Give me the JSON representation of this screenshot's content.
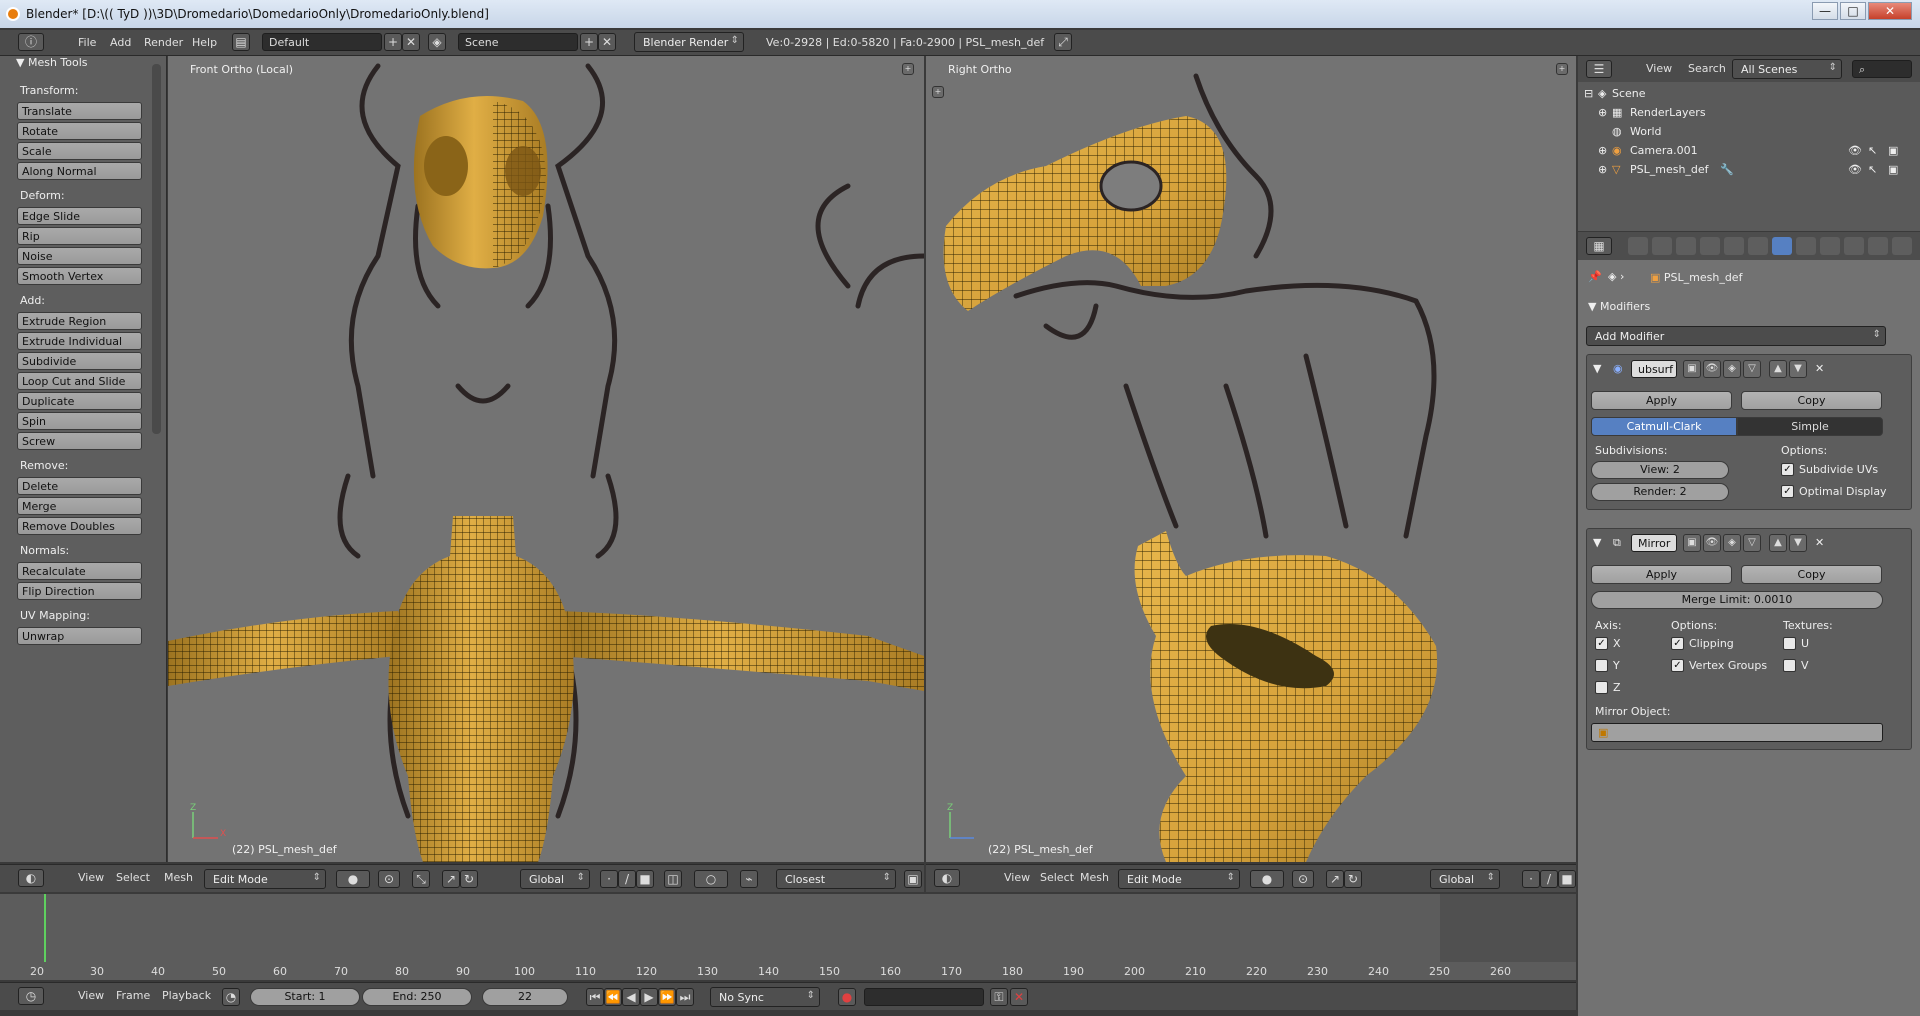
{
  "window": {
    "title": "Blender* [D:\\(( TyD ))\\3D\\Dromedario\\DomedarioOnly\\DromedarioOnly.blend]",
    "buttons": [
      "—",
      "□",
      "✕"
    ]
  },
  "infobar": {
    "menus": [
      "File",
      "Add",
      "Render",
      "Help"
    ],
    "layout": "Default",
    "scene": "Scene",
    "engine": "Blender Render",
    "stats": "Ve:0-2928 | Ed:0-5820 | Fa:0-2900 | PSL_mesh_def"
  },
  "toolshelf": {
    "title": "Mesh Tools",
    "sections": [
      {
        "label": "Transform:",
        "buttons": [
          "Translate",
          "Rotate",
          "Scale",
          "Along Normal"
        ]
      },
      {
        "label": "Deform:",
        "buttons": [
          "Edge Slide",
          "Rip",
          "Noise",
          "Smooth Vertex"
        ]
      },
      {
        "label": "Add:",
        "buttons": [
          "Extrude Region",
          "Extrude Individual",
          "Subdivide",
          "Loop Cut and Slide",
          "Duplicate",
          "Spin",
          "Screw"
        ]
      },
      {
        "label": "Remove:",
        "buttons": [
          "Delete",
          "Merge",
          "Remove Doubles"
        ]
      },
      {
        "label": "Normals:",
        "buttons": [
          "Recalculate",
          "Flip Direction"
        ]
      },
      {
        "label": "UV Mapping:",
        "buttons": [
          "Unwrap"
        ]
      }
    ]
  },
  "viewport_left": {
    "label": "Front Ortho (Local)",
    "footer": "(22) PSL_mesh_def",
    "header": {
      "menus": [
        "View",
        "Select",
        "Mesh"
      ],
      "mode": "Edit Mode",
      "orientation": "Global",
      "snap": "Closest"
    }
  },
  "viewport_right": {
    "label": "Right Ortho",
    "footer": "(22) PSL_mesh_def",
    "header": {
      "menus": [
        "View",
        "Select",
        "Mesh"
      ],
      "mode": "Edit Mode",
      "orientation": "Global"
    }
  },
  "timeline": {
    "ticks": [
      "20",
      "30",
      "40",
      "50",
      "60",
      "70",
      "80",
      "90",
      "100",
      "110",
      "120",
      "130",
      "140",
      "150",
      "160",
      "170",
      "180",
      "190",
      "200",
      "210",
      "220",
      "230",
      "240",
      "250",
      "260"
    ],
    "menus": [
      "View",
      "Frame",
      "Playback"
    ],
    "start": "Start: 1",
    "end": "End: 250",
    "current": "22",
    "sync": "No Sync"
  },
  "outliner": {
    "menus": [
      "View",
      "Search"
    ],
    "filter": "All Scenes",
    "items": [
      "Scene",
      "RenderLayers",
      "World",
      "Camera.001",
      "PSL_mesh_def"
    ]
  },
  "properties": {
    "object": "PSL_mesh_def",
    "section": "Modifiers",
    "add_modifier": "Add Modifier",
    "subsurf": {
      "name": "ubsurf",
      "apply": "Apply",
      "copy": "Copy",
      "catmull": "Catmull-Clark",
      "simple": "Simple",
      "subdivisions": "Subdivisions:",
      "options": "Options:",
      "view": "View: 2",
      "render": "Render: 2",
      "subdivide_uvs": "Subdivide UVs",
      "optimal_display": "Optimal Display"
    },
    "mirror": {
      "name": "Mirror",
      "apply": "Apply",
      "copy": "Copy",
      "merge_limit": "Merge Limit: 0.0010",
      "axis": "Axis:",
      "options": "Options:",
      "textures": "Textures:",
      "x": "X",
      "y": "Y",
      "z": "Z",
      "clipping": "Clipping",
      "vertex_groups": "Vertex Groups",
      "u": "U",
      "v": "V",
      "mirror_object": "Mirror Object:"
    }
  },
  "colors": {
    "mesh": "#d9a63c",
    "wire": "#2a2000",
    "sketch": "#2b2424",
    "accent": "#5680c2"
  }
}
